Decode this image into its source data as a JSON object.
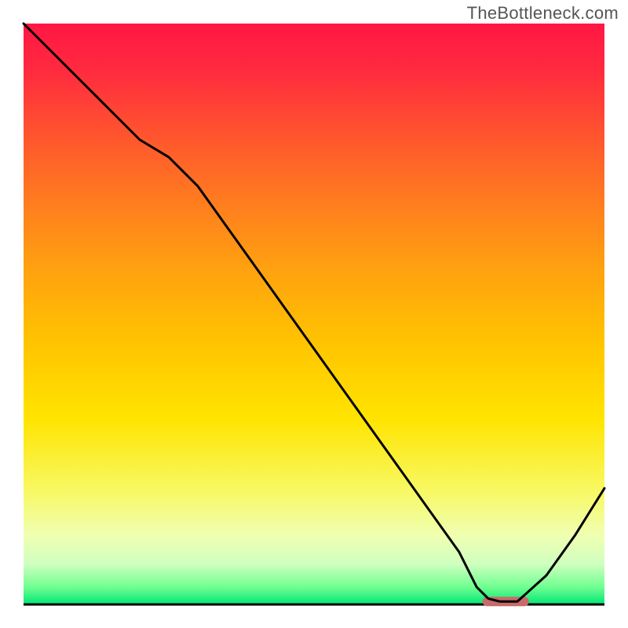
{
  "brand": "TheBottleneck.com",
  "chart_data": {
    "type": "line",
    "title": "",
    "xlabel": "",
    "ylabel": "",
    "xlim": [
      0,
      100
    ],
    "ylim": [
      0,
      100
    ],
    "x": [
      0,
      5,
      10,
      15,
      20,
      25,
      30,
      35,
      40,
      45,
      50,
      55,
      60,
      65,
      70,
      75,
      78,
      80,
      82,
      85,
      90,
      95,
      100
    ],
    "values": [
      100,
      95,
      90,
      85,
      80,
      77,
      72,
      65,
      58,
      51,
      44,
      37,
      30,
      23,
      16,
      9,
      3,
      1,
      0.5,
      0.5,
      5,
      12,
      20
    ],
    "optimal_zone": {
      "x_start": 79,
      "x_end": 87,
      "y": 0.5
    },
    "gradient_stops": [
      {
        "offset": 0.0,
        "color": "#ff1744"
      },
      {
        "offset": 0.08,
        "color": "#ff2a3f"
      },
      {
        "offset": 0.18,
        "color": "#ff5030"
      },
      {
        "offset": 0.3,
        "color": "#ff7a20"
      },
      {
        "offset": 0.42,
        "color": "#ffa010"
      },
      {
        "offset": 0.55,
        "color": "#ffc400"
      },
      {
        "offset": 0.68,
        "color": "#ffe400"
      },
      {
        "offset": 0.8,
        "color": "#f8f860"
      },
      {
        "offset": 0.88,
        "color": "#f0ffb0"
      },
      {
        "offset": 0.93,
        "color": "#d0ffc0"
      },
      {
        "offset": 0.97,
        "color": "#70ff90"
      },
      {
        "offset": 1.0,
        "color": "#00e676"
      }
    ],
    "line_color": "#000000",
    "line_width": 3,
    "optimal_marker_color": "#c96a6a",
    "optimal_marker_height": 12
  }
}
